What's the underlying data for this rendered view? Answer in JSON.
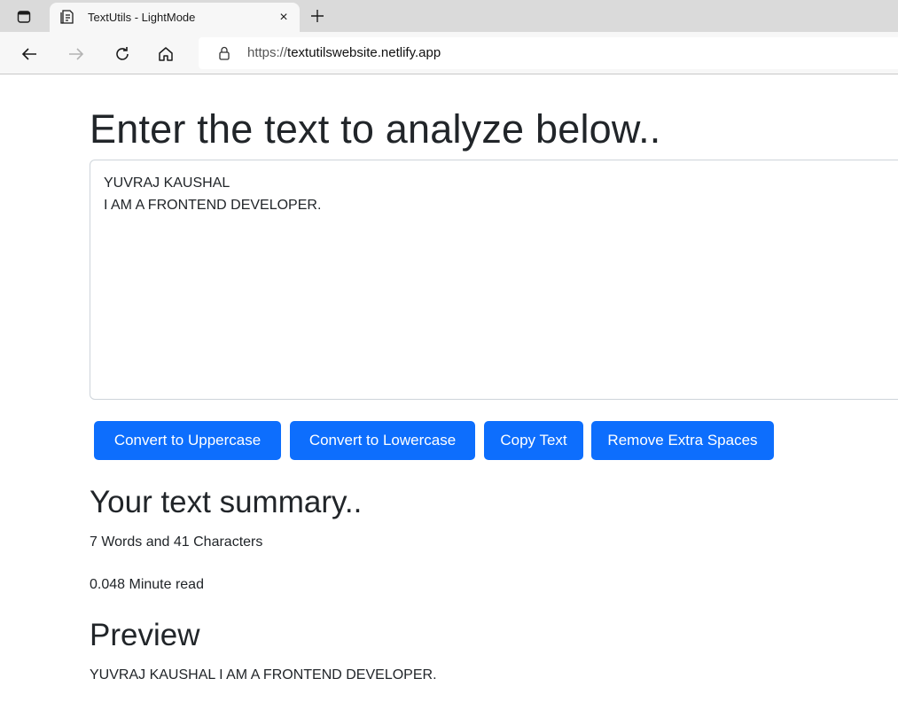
{
  "browser": {
    "tab": {
      "title": "TextUtils - LightMode",
      "close_glyph": "×"
    },
    "new_tab_glyph": "+",
    "address": {
      "scheme": "https://",
      "host": "textutilswebsite.netlify.app"
    },
    "icons": [
      "tab-actions-icon",
      "document-favicon-icon",
      "close-icon",
      "plus-icon",
      "back-arrow-icon",
      "forward-arrow-icon",
      "refresh-icon",
      "home-icon",
      "lock-icon"
    ]
  },
  "page": {
    "heading": "Enter the text to analyze below..",
    "textarea_value": "YUVRAJ KAUSHAL\nI AM A FRONTEND DEVELOPER.",
    "buttons": {
      "uppercase": "Convert to Uppercase",
      "lowercase": "Convert to Lowercase",
      "copy": "Copy Text",
      "extra_spaces": "Remove Extra Spaces"
    },
    "summary": {
      "heading": "Your text summary..",
      "counts": "7 Words and 41 Characters",
      "read_time": "0.048 Minute read"
    },
    "preview": {
      "heading": "Preview",
      "text": "YUVRAJ KAUSHAL I AM A FRONTEND DEVELOPER."
    }
  },
  "colors": {
    "primary_button": "#0d6efd",
    "text": "#212529",
    "tabstrip": "#dadada",
    "toolbar": "#f7f7f7"
  }
}
